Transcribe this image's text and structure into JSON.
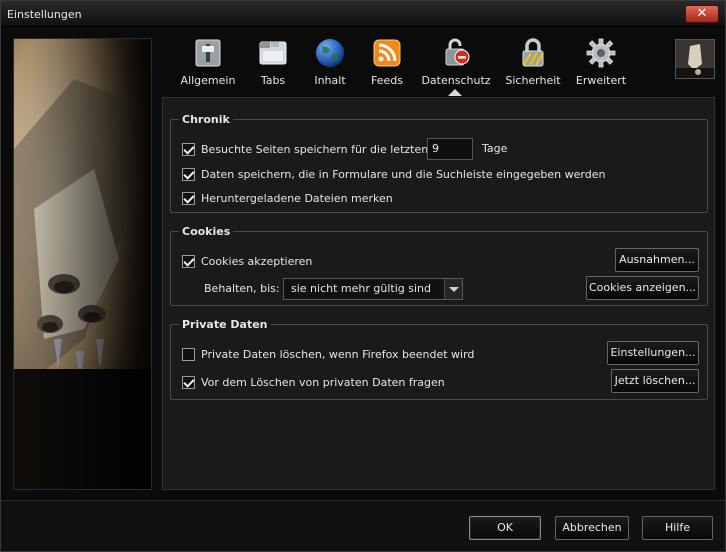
{
  "window": {
    "title": "Einstellungen",
    "close_label": "✕"
  },
  "toolbar": {
    "tabs": [
      {
        "label": "Allgemein",
        "icon": "general-switch-icon"
      },
      {
        "label": "Tabs",
        "icon": "tabs-window-icon"
      },
      {
        "label": "Inhalt",
        "icon": "globe-icon"
      },
      {
        "label": "Feeds",
        "icon": "rss-feed-icon"
      },
      {
        "label": "Datenschutz",
        "icon": "privacy-icon"
      },
      {
        "label": "Sicherheit",
        "icon": "padlock-icon"
      },
      {
        "label": "Erweitert",
        "icon": "gear-icon"
      }
    ],
    "selected_tab": "Datenschutz"
  },
  "chronik": {
    "title": "Chronik",
    "history_label": "Besuchte Seiten speichern für die letzten",
    "history_checked": true,
    "history_days": "9",
    "history_unit": "Tage",
    "forms_label": "Daten speichern, die in Formulare und die Suchleiste eingegeben werden",
    "forms_checked": true,
    "downloads_label": "Heruntergeladene Dateien merken",
    "downloads_checked": true
  },
  "cookies": {
    "title": "Cookies",
    "accept_label": "Cookies akzeptieren",
    "accept_checked": true,
    "exceptions_button": "Ausnahmen...",
    "keep_label": "Behalten, bis:",
    "keep_value": "sie nicht mehr gültig sind",
    "show_button": "Cookies anzeigen..."
  },
  "private_data": {
    "title": "Private Daten",
    "clear_on_exit_label": "Private Daten löschen, wenn Firefox beendet wird",
    "clear_on_exit_checked": false,
    "settings_button": "Einstellungen...",
    "ask_before_label": "Vor dem Löschen von privaten Daten fragen",
    "ask_before_checked": true,
    "clear_now_button": "Jetzt löschen..."
  },
  "footer": {
    "ok_label": "OK",
    "cancel_label": "Abbrechen",
    "help_label": "Hilfe"
  },
  "colors": {
    "background": "#0b0b0b",
    "panel": "#1a1a1a",
    "text": "#e6e6e6",
    "close_button": "#c0392b"
  }
}
